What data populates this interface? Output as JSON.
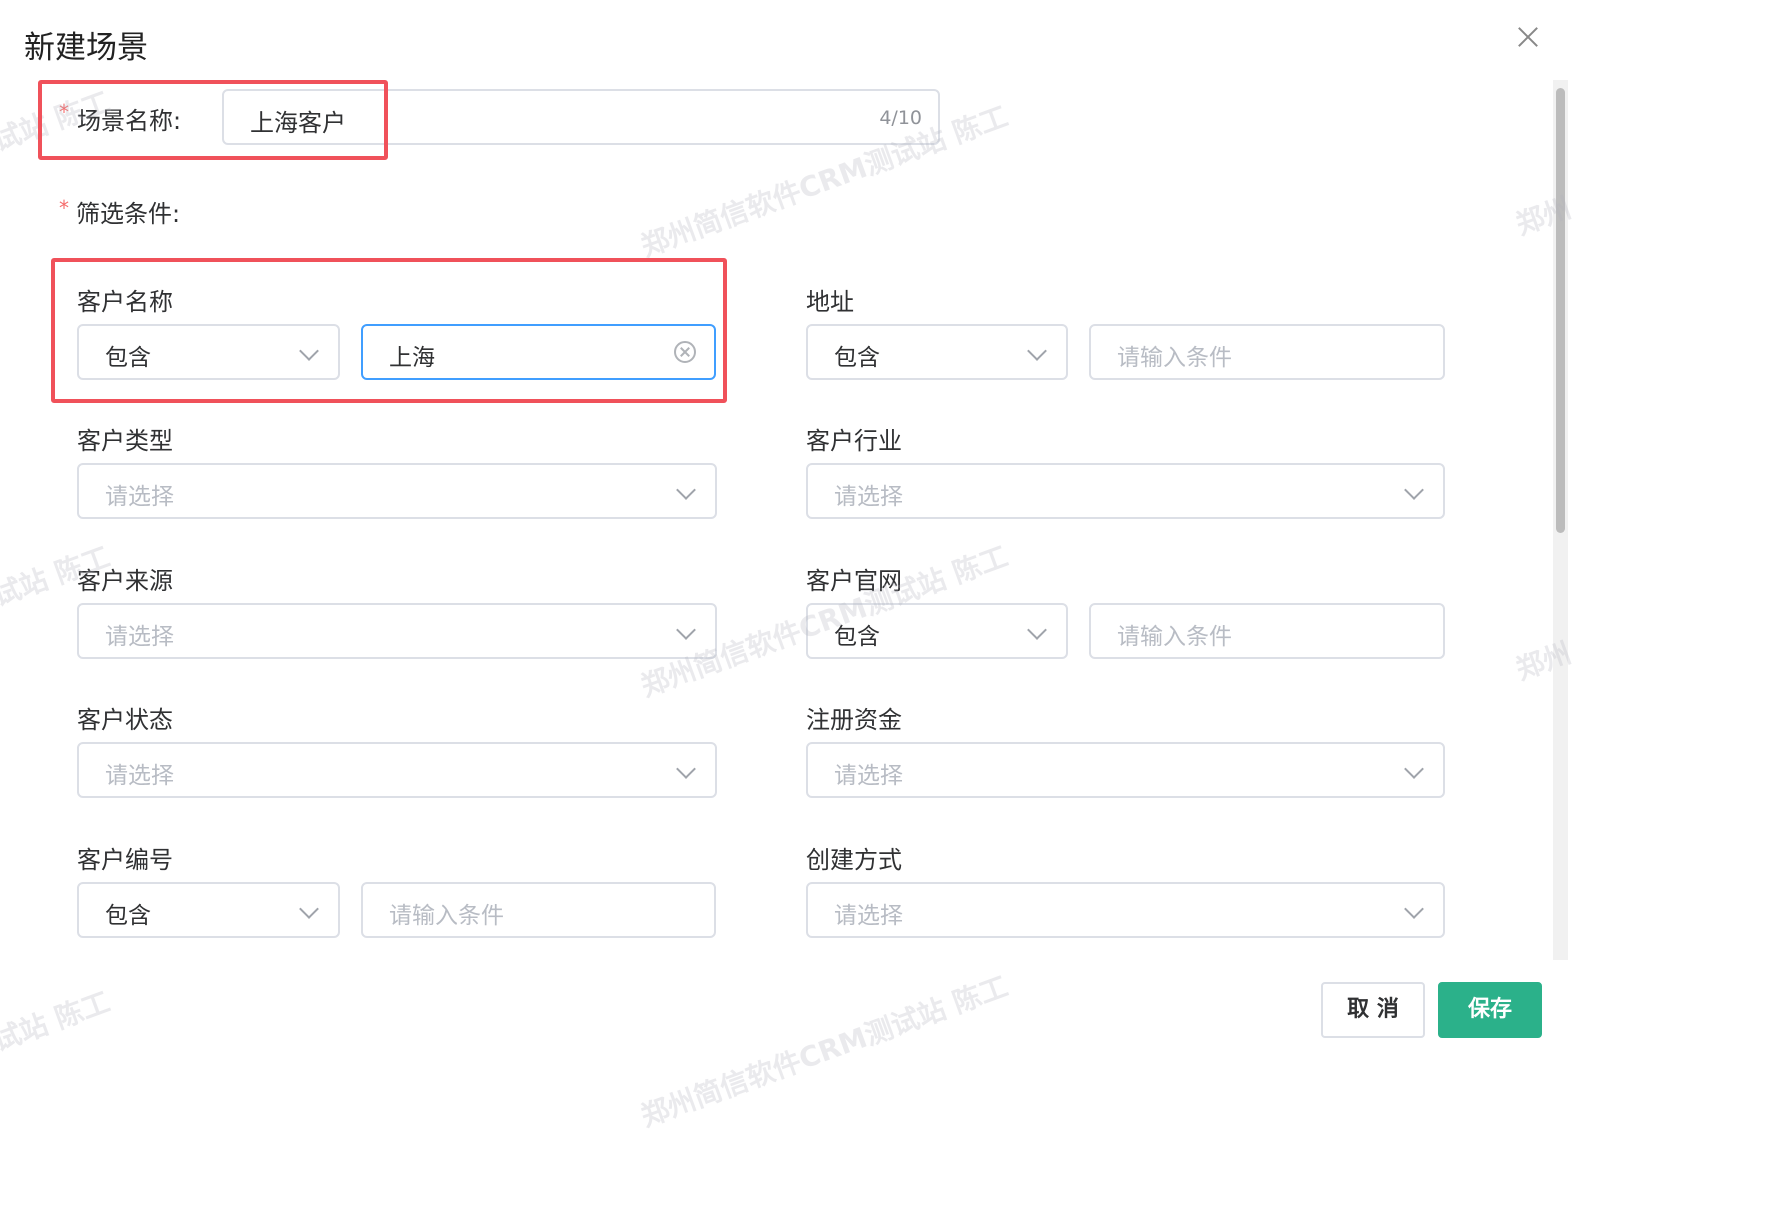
{
  "dialog": {
    "title": "新建场景",
    "close_icon": "close-icon"
  },
  "scene_name": {
    "required_mark": "*",
    "label": "场景名称:",
    "value": "上海客户",
    "counter": "4/10"
  },
  "filter": {
    "required_mark": "*",
    "label": "筛选条件:"
  },
  "fields": {
    "customer_name": {
      "label": "客户名称",
      "operator": "包含",
      "value": "上海"
    },
    "address": {
      "label": "地址",
      "operator": "包含",
      "placeholder": "请输入条件"
    },
    "customer_type": {
      "label": "客户类型",
      "placeholder": "请选择"
    },
    "customer_industry": {
      "label": "客户行业",
      "placeholder": "请选择"
    },
    "customer_source": {
      "label": "客户来源",
      "placeholder": "请选择"
    },
    "customer_website": {
      "label": "客户官网",
      "operator": "包含",
      "placeholder": "请输入条件"
    },
    "customer_status": {
      "label": "客户状态",
      "placeholder": "请选择"
    },
    "registered_capital": {
      "label": "注册资金",
      "placeholder": "请选择"
    },
    "customer_number": {
      "label": "客户编号",
      "operator": "包含",
      "placeholder": "请输入条件"
    },
    "creation_method": {
      "label": "创建方式",
      "placeholder": "请选择"
    }
  },
  "footer": {
    "cancel_label": "取 消",
    "save_label": "保存"
  },
  "watermark": {
    "text_long": "郑州简信软件CRM测试站 陈工",
    "text_short": "试站 陈工",
    "text_tail": "郑州"
  },
  "colors": {
    "highlight": "#f0515a",
    "primary_button": "#2bb18a",
    "focus_border": "#409eff",
    "required": "#f56c6c"
  }
}
